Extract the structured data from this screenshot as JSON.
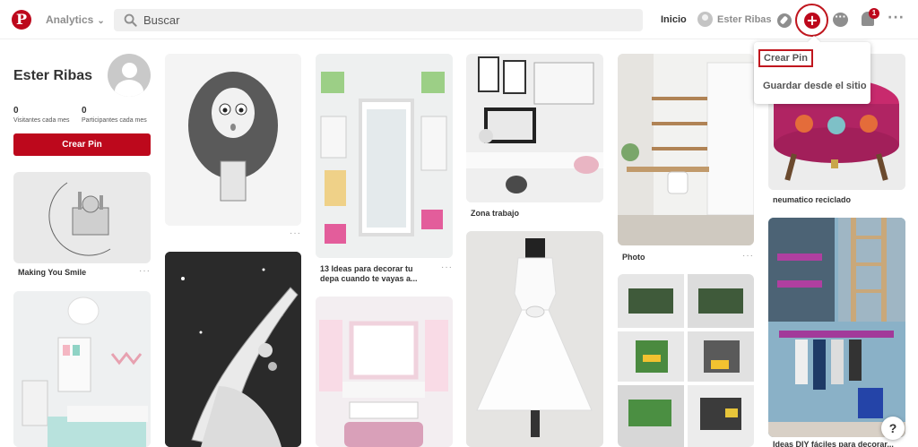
{
  "topbar": {
    "logo_letter": "P",
    "analytics_label": "Analytics",
    "search_placeholder": "Buscar",
    "inicio": "Inicio",
    "user_name": "Ester Ribas",
    "notification_count": "1",
    "more": "···",
    "plus": "+"
  },
  "dropdown": {
    "create_pin": "Crear Pin",
    "save_from_site": "Guardar desde el sitio"
  },
  "profile": {
    "name": "Ester Ribas",
    "visitors_count": "0",
    "visitors_label": "Visitantes cada mes",
    "participants_count": "0",
    "participants_label": "Participantes cada mes",
    "create_pin_button": "Crear Pin"
  },
  "pins": [
    {
      "id": "moon",
      "caption": "Making You Smile"
    },
    {
      "id": "girl-sketch",
      "caption": ""
    },
    {
      "id": "mirror-room",
      "caption": "13 Ideas para decorar tu depa cuando te vayas a..."
    },
    {
      "id": "desk",
      "caption": "Zona trabajo"
    },
    {
      "id": "photo-room",
      "caption": "Photo"
    },
    {
      "id": "pouf",
      "caption": "neumatico reciclado"
    },
    {
      "id": "kids-room",
      "caption": ""
    },
    {
      "id": "star-art",
      "caption": ""
    },
    {
      "id": "vanity",
      "caption": ""
    },
    {
      "id": "dress",
      "caption": ""
    },
    {
      "id": "garage-toy",
      "caption": ""
    },
    {
      "id": "ladder",
      "caption": "Ideas DIY fáciles para decorar..."
    }
  ],
  "help_label": "?",
  "colors": {
    "brand": "#bd081c",
    "search_bg": "#efefef"
  }
}
